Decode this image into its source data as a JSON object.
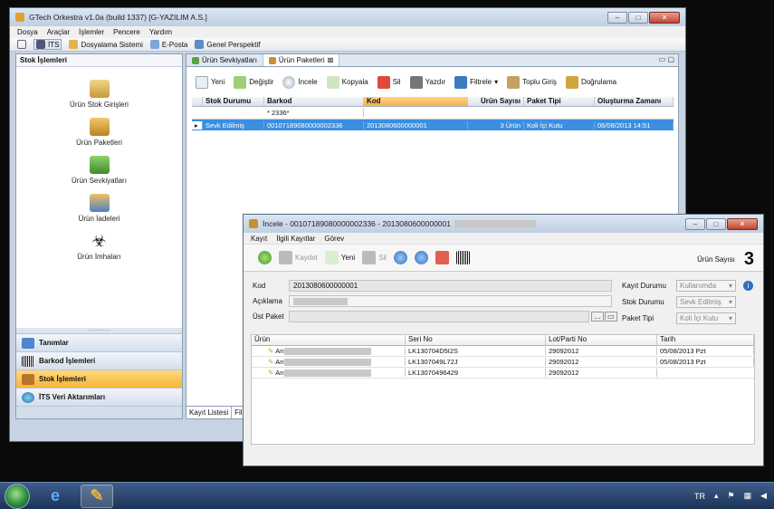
{
  "main_window": {
    "title": "GTech Orkestra v1.0a (build 1337) [G-YAZILIM A.S.]",
    "menu": [
      "Dosya",
      "Araçlar",
      "İşlemler",
      "Pencere",
      "Yardım"
    ],
    "toolbar": [
      "İTS",
      "Dosyalama Sistemi",
      "E-Posta",
      "Genel Perspektif"
    ]
  },
  "left_panel": {
    "title": "Stok İşlemleri",
    "launchers": [
      "Ürün Stok Girişleri",
      "Ürün Paketleri",
      "Ürün Sevkiyatları",
      "Ürün İadeleri",
      "Ürün İmhaları"
    ],
    "sections": [
      "Tanımlar",
      "Barkod İşlemleri",
      "Stok İşlemleri",
      "İTS Veri Aktarımları"
    ]
  },
  "tabs": [
    "Ürün Sevkiyatları",
    "Ürün Paketleri"
  ],
  "actions": [
    "Yeni",
    "Değiştir",
    "İncele",
    "Kopyala",
    "Sil",
    "Yazdır",
    "Filtrele",
    "Toplu Giriş",
    "Doğrulama"
  ],
  "grid": {
    "columns": [
      "Stok Durumu",
      "Barkod",
      "Kod",
      "Ürün Sayısı",
      "Paket Tipi",
      "Oluşturma Zamanı"
    ],
    "filter": "* 2336*",
    "row": {
      "stok_durumu": "Sevk Edilmiş",
      "barkod": "00107189080000002336",
      "kod": "2013080600000001",
      "urun_sayisi": "3 Ürün",
      "paket_tipi": "Koli İçi Kutu",
      "olusturma": "06/08/2013 14:51"
    }
  },
  "bottom_tabs": [
    "Kayıt Listesi",
    "Filtre"
  ],
  "dialog": {
    "title": "İncele - 00107189080000002336 - 2013080600000001",
    "menu": [
      "Kayıt",
      "İlgili Kayıtlar",
      "Görev"
    ],
    "toolbar": [
      "Kaydet",
      "Yeni",
      "Sil"
    ],
    "count_label": "Ürün Sayısı",
    "count_value": "3",
    "kod_label": "Kod",
    "kod_value": "2013080600000001",
    "aciklama_label": "Açıklama",
    "ust_paket_label": "Üst Paket",
    "kayit_durumu_label": "Kayıt Durumu",
    "kayit_durumu_value": "Kullanımda",
    "stok_durumu_label": "Stok Durumu",
    "stok_durumu_value": "Sevk Edilmiş",
    "paket_tipi_label": "Paket Tipi",
    "paket_tipi_value": "Koli İçi Kutu",
    "grid_columns": [
      "Ürün",
      "Seri No",
      "Lot/Parti No",
      "Tarih"
    ],
    "rows": [
      {
        "urun": "Arı",
        "seri": "LK130704D5I2S",
        "lot": "29092012",
        "tarih": "05/08/2013 Pzt"
      },
      {
        "urun": "Arı",
        "seri": "LK1307049L72J",
        "lot": "29092012",
        "tarih": "05/08/2013 Pzt"
      },
      {
        "urun": "Arı",
        "seri": "LK1307049642​9",
        "lot": "29092012",
        "tarih": ""
      }
    ]
  },
  "taskbar": {
    "language": "TR"
  }
}
